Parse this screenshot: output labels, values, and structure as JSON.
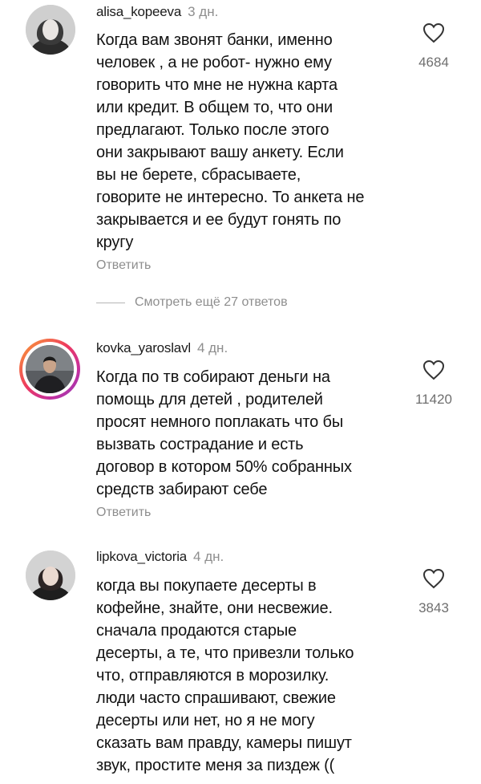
{
  "comments": [
    {
      "username": "alisa_kopeeva",
      "time": "3 дн.",
      "text": "Когда вам звонят банки, именно\nчеловек , а не робот- нужно ему\nговорить что мне не нужна карта\nили кредит. В общем то, что они\nпредлагают. Только после этого\nони закрывают вашу анкету. Если\nвы не берете, сбрасываете,\nговорите не интересно. То анкета не\nзакрывается и ее будут гонять по\nкругу",
      "likes": "4684",
      "reply_label": "Ответить"
    },
    {
      "username": "kovka_yaroslavl",
      "time": "4 дн.",
      "text": "Когда по тв собирают деньги на\nпомощь для детей , родителей\nпросят немного поплакать что бы\nвызвать сострадание и есть\nдоговор в котором 50% собранных\nсредств забирают себе",
      "likes": "11420",
      "reply_label": "Ответить"
    },
    {
      "username": "lipkova_victoria",
      "time": "4 дн.",
      "text": "когда вы покупаете десерты в\nкофейне, знайте, они несвежие.\nсначала продаются старые\nдесерты, а те, что привезли только\nчто, отправляются в морозилку.\nлюди часто спрашивают, свежие\nдесерты или нет, но я не могу\nсказать вам правду, камеры пишут\nзвук, простите меня за пиздеж ((",
      "likes": "3843"
    }
  ],
  "view_more_replies": "Смотреть ещё 27 ответов",
  "icons": {
    "like": "heart-outline-icon"
  }
}
